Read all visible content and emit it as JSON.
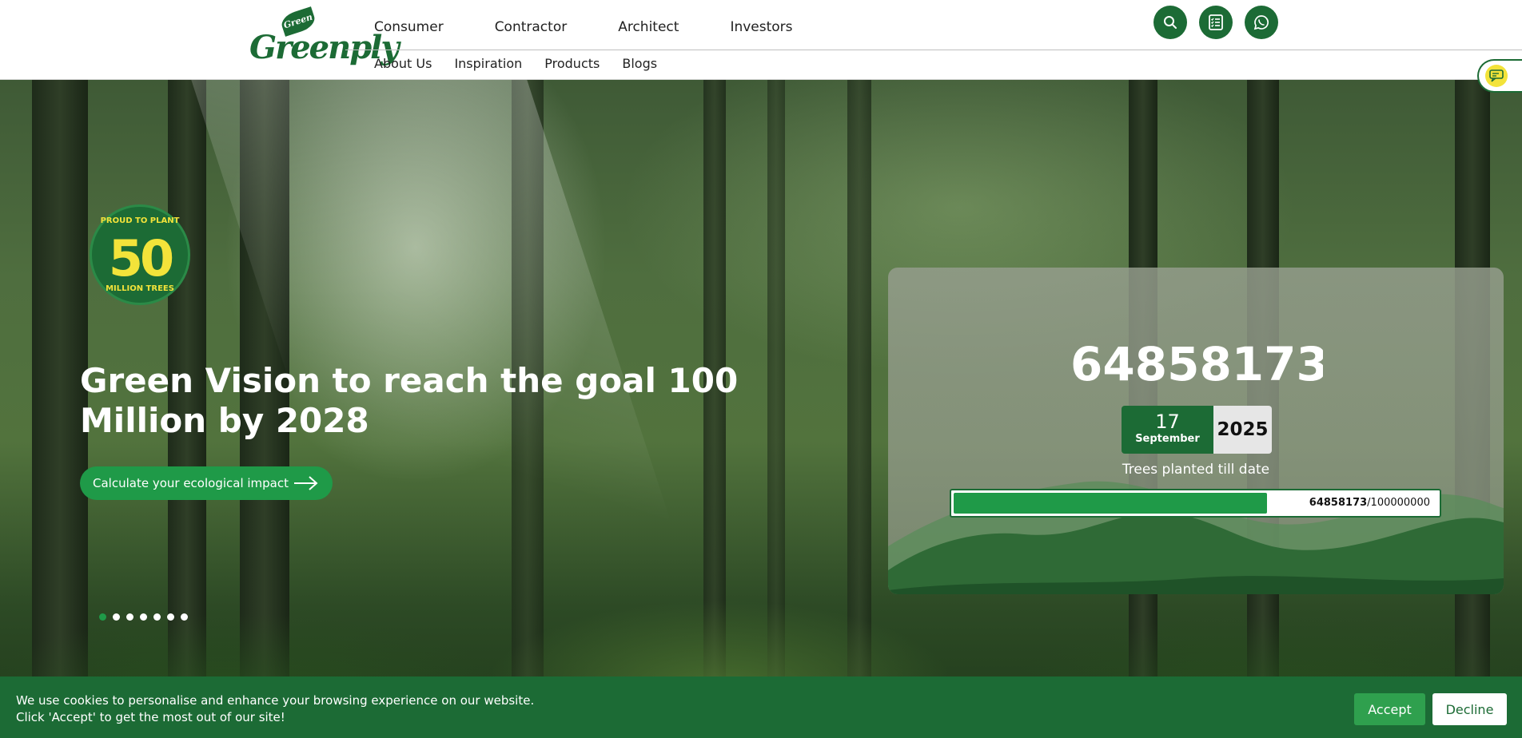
{
  "header": {
    "logo_text": "Greenply",
    "logo_leaf_text": "Green",
    "main_nav": [
      "Consumer",
      "Contractor",
      "Architect",
      "Investors"
    ],
    "sub_nav": [
      "About Us",
      "Inspiration",
      "Products",
      "Blogs"
    ],
    "icons": [
      "search-icon",
      "checklist-icon",
      "whatsapp-icon"
    ]
  },
  "hero": {
    "badge": {
      "top_text": "PROUD TO PLANT",
      "number": "50",
      "bottom_text": "MILLION TREES"
    },
    "title": "Green Vision to reach the goal 100 Million by 2028",
    "cta_label": "Calculate your ecological impact",
    "slider_dots": 7,
    "active_dot": 0
  },
  "counter": {
    "odometer_digits": [
      "6",
      "4",
      "8",
      "5",
      "8",
      "1",
      "7",
      "3"
    ],
    "date_day": "17",
    "date_month": "September",
    "date_year": "2025",
    "label": "Trees planted till date",
    "planted": "64858173",
    "goal": "/100000000",
    "progress_fraction": 0.648
  },
  "cookie": {
    "line1": "We use cookies to personalise and enhance your browsing experience on our website.",
    "line2": "Click 'Accept' to get the most out of our site!",
    "accept_label": "Accept",
    "decline_label": "Decline"
  },
  "colors": {
    "brand_green": "#1c6b35",
    "accent_green": "#1f9a48",
    "badge_yellow": "#f3e33a"
  }
}
